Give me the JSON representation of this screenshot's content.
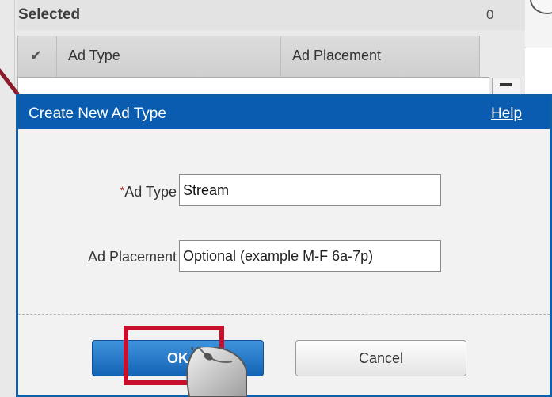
{
  "background": {
    "selected_title": "Selected",
    "selected_count": "0",
    "columns": {
      "check_icon": "✔",
      "ad_type": "Ad Type",
      "ad_placement": "Ad Placement"
    }
  },
  "dialog": {
    "title": "Create New Ad Type",
    "help_link": "Help",
    "required_marker": "*",
    "fields": {
      "ad_type": {
        "label": "Ad Type",
        "value": "Stream"
      },
      "ad_placement": {
        "label": "Ad Placement",
        "placeholder": "Optional (example M-F 6a-7p)"
      }
    },
    "buttons": {
      "ok": "OK",
      "cancel": "Cancel"
    }
  },
  "colors": {
    "titlebar": "#0a5cb0",
    "highlight": "#c8102e",
    "ok_button": "#1463b5"
  },
  "icons": [
    "checkmark-icon",
    "minus-icon",
    "mouse-icon"
  ]
}
